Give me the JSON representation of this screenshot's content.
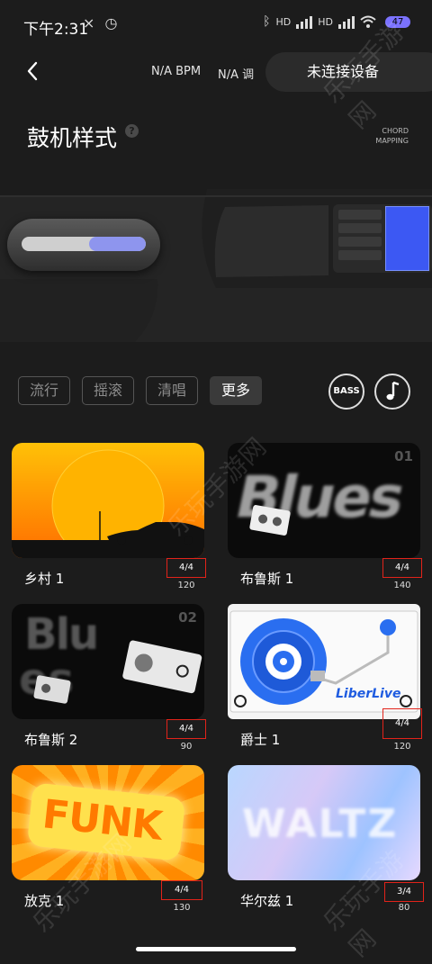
{
  "status": {
    "time": "下午2:31",
    "battery": "47",
    "signal1": "HD",
    "signal2": "HD"
  },
  "header": {
    "bpm": "N/A BPM",
    "key": "N/A 调",
    "device_button": "未连接设备"
  },
  "page": {
    "title": "鼓机样式",
    "help": "?",
    "chord_mapping_line1": "CHORD",
    "chord_mapping_line2": "MAPPING"
  },
  "device_preview": {
    "slider_level_percent": 46
  },
  "categories": [
    {
      "label": "流行",
      "active": false
    },
    {
      "label": "摇滚",
      "active": false
    },
    {
      "label": "清唱",
      "active": false
    },
    {
      "label": "更多",
      "active": true
    }
  ],
  "bass_button": "BASS",
  "styles": [
    {
      "name": "乡村 1",
      "time_signature": "4/4",
      "tempo": "120",
      "art": "country"
    },
    {
      "name": "布鲁斯 1",
      "time_signature": "4/4",
      "tempo": "140",
      "art": "blues1",
      "art_text": "Blues",
      "art_number": "01"
    },
    {
      "name": "布鲁斯 2",
      "time_signature": "4/4",
      "tempo": "90",
      "art": "blues2",
      "art_text": "Blu",
      "art_text2": "es",
      "art_number": "02"
    },
    {
      "name": "爵士 1",
      "time_signature": "4/4",
      "tempo": "120",
      "art": "jazz",
      "art_text": "LiberLive"
    },
    {
      "name": "放克 1",
      "time_signature": "4/4",
      "tempo": "130",
      "art": "funk",
      "art_text": "FUNK"
    },
    {
      "name": "华尔兹 1",
      "time_signature": "3/4",
      "tempo": "80",
      "art": "waltz",
      "art_text": "WALTZ"
    }
  ],
  "watermark": "乐玩手游网"
}
